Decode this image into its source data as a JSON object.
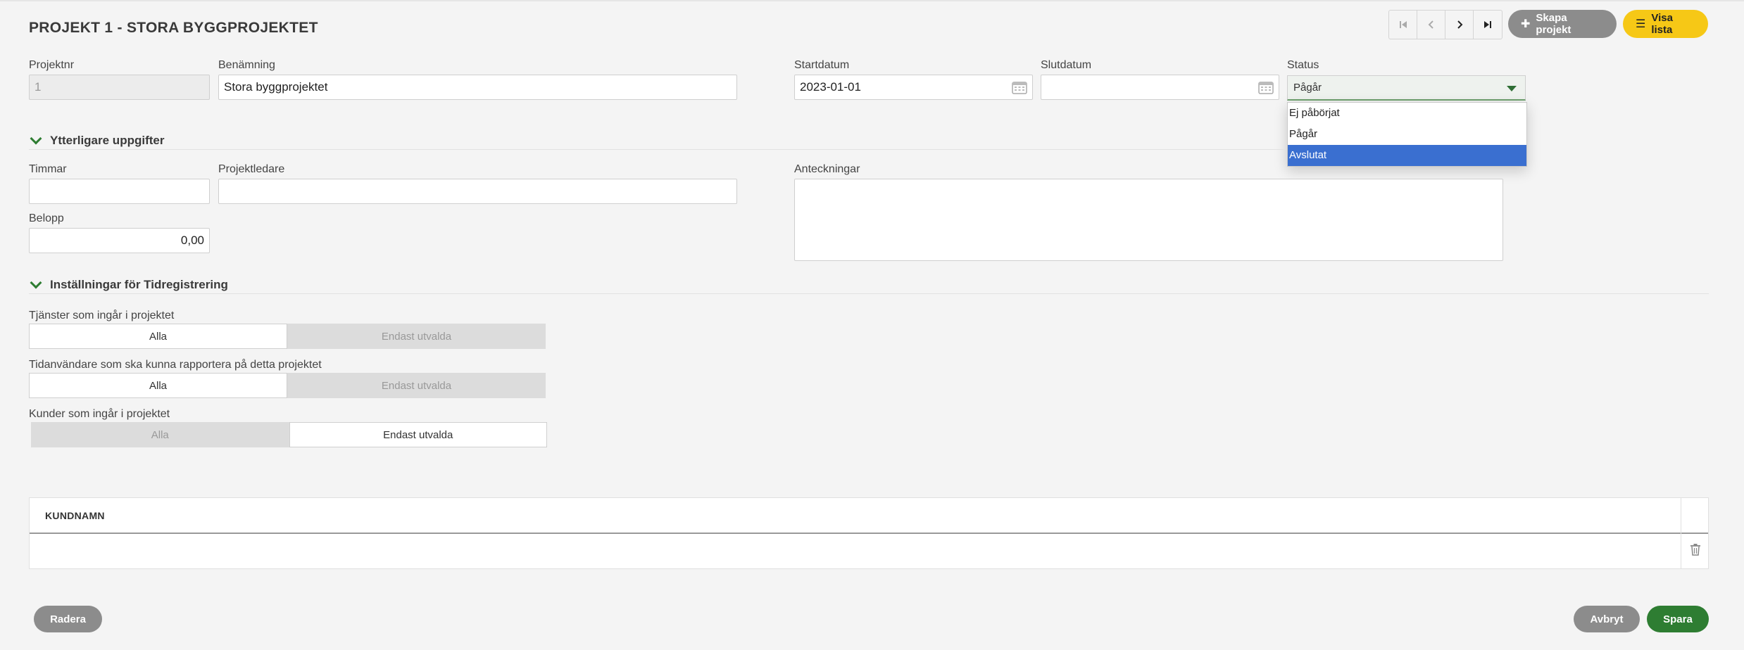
{
  "header": {
    "title": "PROJEKT 1 - STORA BYGGPROJEKTET",
    "nav_first_icon": "first-page-icon",
    "nav_prev_icon": "chevron-left-icon",
    "nav_next_icon": "chevron-right-icon",
    "nav_last_icon": "last-page-icon",
    "create_label": "Skapa projekt",
    "list_label": "Visa lista"
  },
  "fields": {
    "projektnr": {
      "label": "Projektnr",
      "value": "1"
    },
    "benamning": {
      "label": "Benämning",
      "value": "Stora byggprojektet"
    },
    "startdatum": {
      "label": "Startdatum",
      "value": "2023-01-01"
    },
    "slutdatum": {
      "label": "Slutdatum",
      "value": ""
    },
    "status": {
      "label": "Status",
      "value": "Pågår",
      "options": [
        "Ej påbörjat",
        "Pågår",
        "Avslutat"
      ],
      "highlighted": "Avslutat"
    }
  },
  "section_more": {
    "title": "Ytterligare uppgifter",
    "timmar": {
      "label": "Timmar",
      "value": ""
    },
    "projektledare": {
      "label": "Projektledare",
      "value": ""
    },
    "belopp": {
      "label": "Belopp",
      "value": "0,00"
    },
    "anteckningar": {
      "label": "Anteckningar",
      "value": ""
    }
  },
  "section_time": {
    "title": "Inställningar för Tidregistrering",
    "tjanster": {
      "label": "Tjänster som ingår i projektet",
      "option_all": "Alla",
      "option_selected": "Endast utvalda",
      "active": "Alla"
    },
    "tidanvandare": {
      "label": "Tidanvändare som ska kunna rapportera på detta projektet",
      "option_all": "Alla",
      "option_selected": "Endast utvalda",
      "active": "Alla"
    },
    "kunder": {
      "label": "Kunder som ingår i projektet",
      "option_all": "Alla",
      "option_selected": "Endast utvalda",
      "active": "Endast utvalda"
    }
  },
  "table": {
    "columns": [
      "KUNDNAMN"
    ],
    "rows": [
      [
        ""
      ]
    ]
  },
  "footer": {
    "delete_label": "Radera",
    "cancel_label": "Avbryt",
    "save_label": "Spara"
  },
  "colors": {
    "accent_green": "#2e7d32",
    "accent_yellow": "#f6c816",
    "neutral_button": "#8c8c8c",
    "highlight_blue": "#3a6fd0"
  }
}
